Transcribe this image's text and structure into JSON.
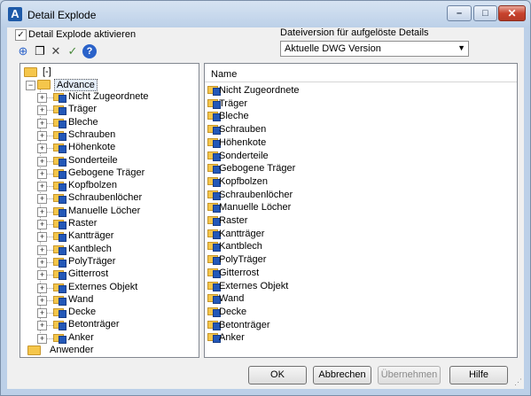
{
  "window": {
    "title": "Detail Explode",
    "app_icon_letter": "A",
    "controls": {
      "minimize": "–",
      "maximize": "□",
      "close": "✕"
    }
  },
  "options": {
    "checkbox_checked": true,
    "checkbox_label": "Detail Explode aktivieren",
    "version_label": "Dateiversion für aufgelöste Details",
    "version_value": "Aktuelle DWG Version"
  },
  "toolbar": {
    "icons": [
      "add-icon",
      "copy-icon",
      "delete-icon",
      "properties-icon",
      "help-icon"
    ],
    "glyphs": [
      "⊕",
      "❐",
      "✕",
      "✓",
      "?"
    ]
  },
  "tree": {
    "root": {
      "label": "[-]"
    },
    "advance": {
      "label": "Advance"
    },
    "children": [
      "Nicht Zugeordnete",
      "Träger",
      "Bleche",
      "Schrauben",
      "Höhenkote",
      "Sonderteile",
      "Gebogene Träger",
      "Kopfbolzen",
      "Schraubenlöcher",
      "Manuelle Löcher",
      "Raster",
      "Kantträger",
      "Kantblech",
      "PolyTräger",
      "Gitterrost",
      "Externes Objekt",
      "Wand",
      "Decke",
      "Betonträger",
      "Anker"
    ],
    "user": {
      "label": "Anwender"
    }
  },
  "list": {
    "column_header": "Name",
    "items": [
      "Nicht Zugeordnete",
      "Träger",
      "Bleche",
      "Schrauben",
      "Höhenkote",
      "Sonderteile",
      "Gebogene Träger",
      "Kopfbolzen",
      "Schraubenlöcher",
      "Manuelle Löcher",
      "Raster",
      "Kantträger",
      "Kantblech",
      "PolyTräger",
      "Gitterrost",
      "Externes Objekt",
      "Wand",
      "Decke",
      "Betonträger",
      "Anker"
    ]
  },
  "buttons": {
    "ok": "OK",
    "cancel": "Abbrechen",
    "apply": "Übernehmen",
    "help": "Hilfe"
  }
}
